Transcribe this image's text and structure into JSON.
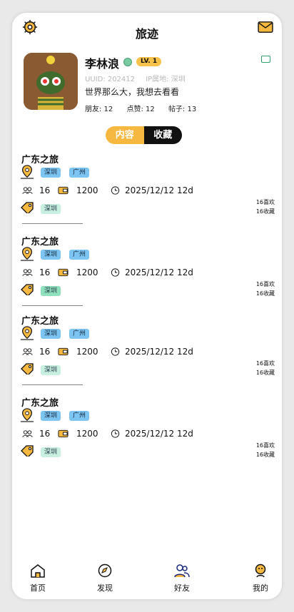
{
  "header": {
    "title": "旅迹",
    "settings_icon": "gear-icon",
    "mail_icon": "mail-icon"
  },
  "profile": {
    "name": "李林浪",
    "level": "LV. 1",
    "uuid": "UUID: 202412",
    "ip_location": "IP属地: 深圳",
    "bio": "世界那么大，我想去看看",
    "friends": "朋友: 12",
    "likes": "点赞: 12",
    "posts": "帖子: 13"
  },
  "segment": {
    "tabs": [
      "内容",
      "收藏"
    ],
    "active_index": 0
  },
  "posts": [
    {
      "title": "广东之旅",
      "tags": [
        "深圳",
        "广州"
      ],
      "people": "16",
      "budget": "1200",
      "date": "2025/12/12 12d",
      "category": "深圳",
      "likes": "16喜欢",
      "favorites": "16收藏"
    },
    {
      "title": "广东之旅",
      "tags": [
        "深圳",
        "广州"
      ],
      "people": "16",
      "budget": "1200",
      "date": "2025/12/12 12d",
      "category": "深圳",
      "likes": "16喜欢",
      "favorites": "16收藏"
    },
    {
      "title": "广东之旅",
      "tags": [
        "深圳",
        "广州"
      ],
      "people": "16",
      "budget": "1200",
      "date": "2025/12/12 12d",
      "category": "深圳",
      "likes": "16喜欢",
      "favorites": "16收藏"
    },
    {
      "title": "广东之旅",
      "tags": [
        "深圳",
        "广州"
      ],
      "people": "16",
      "budget": "1200",
      "date": "2025/12/12 12d",
      "category": "深圳",
      "likes": "16喜欢",
      "favorites": "16收藏"
    }
  ],
  "tabbar": {
    "items": [
      {
        "label": "首页",
        "icon": "home-icon"
      },
      {
        "label": "发现",
        "icon": "compass-icon"
      },
      {
        "label": "好友",
        "icon": "friends-icon"
      },
      {
        "label": "我的",
        "icon": "profile-icon"
      }
    ]
  },
  "colors": {
    "accent": "#f5b942",
    "tag_blue": "#7cc4f2",
    "tag_green": "#c8f0e0",
    "dark": "#111111"
  }
}
